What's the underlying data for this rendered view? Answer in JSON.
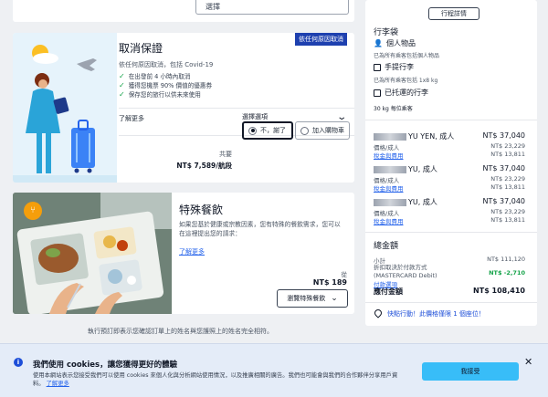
{
  "top_select": {
    "value": "選擇"
  },
  "cancel_card": {
    "badge": "依任何原因取消",
    "title": "取消保證",
    "subtitle": "依任何原因取消，包括 Covid-19",
    "benefits": [
      "在出發前 4 小時內取消",
      "獲得您機票 90% 價值的優惠券",
      "保存您的旅行以供未來使用"
    ],
    "learn_more": "了解更多",
    "price_label": "共要",
    "price_value": "NT$ 7,589/航段",
    "options_heading": "選擇選項",
    "option_no": "不，謝了",
    "option_add": "加入購物車"
  },
  "meal_card": {
    "title": "特殊餐飲",
    "desc": "如果您基於健康或宗教因素，您有特殊的餐飲需求，您可以在這裡提出您的請求：",
    "learn_more": "了解更多",
    "from_label": "從",
    "price": "NT$ 189",
    "button": "瀏覽特殊餐飲"
  },
  "footer_note": "執行預訂即表示您確認訂單上的姓名與您護照上的姓名完全相符。",
  "summary": {
    "trip_button": "行程詳情",
    "baggage_title": "行李袋",
    "personal_item": "個人物品",
    "personal_note": "已為所有乘客包括個人物品",
    "carry_on": "手提行李",
    "carry_on_note": "已為所有乘客包括 1x8 kg",
    "checked": "已托運的行李",
    "checked_note": "30 kg 每位乘客",
    "passengers": [
      {
        "name": "YU YEN, 成人",
        "total": "NT$ 37,040",
        "fare_label": "價格/成人",
        "fare": "NT$ 23,229",
        "tax_label": "稅金與費用",
        "tax": "NT$ 13,811"
      },
      {
        "name": "YU, 成人",
        "total": "NT$ 37,040",
        "fare_label": "價格/成人",
        "fare": "NT$ 23,229",
        "tax_label": "稅金與費用",
        "tax": "NT$ 13,811"
      },
      {
        "name": "YU, 成人",
        "total": "NT$ 37,040",
        "fare_label": "價格/成人",
        "fare": "NT$ 23,229",
        "tax_label": "稅金與費用",
        "tax": "NT$ 13,811"
      }
    ],
    "total_title": "總金額",
    "subtotal_label": "小計",
    "subtotal": "NT$ 111,120",
    "discount_label": "折扣取決於付款方式 (MASTERCARD Debit)",
    "discount": "NT$ -2,710",
    "payment_link": "付款選項",
    "due_label": "應付金額",
    "due": "NT$ 108,410",
    "urgency": "快點行動！此價格僅限 1 個座位！"
  },
  "cookie": {
    "title": "我們使用 cookies，讓您獲得更好的體驗",
    "body": "使用本網站表示您接受我們可以使用 cookies 來個人化與分析網站使用情況，以及推廣相關的廣告。我們也可能會與我們的合作夥伴分享用戶資料。",
    "more": "了解更多",
    "accept": "我接受"
  }
}
